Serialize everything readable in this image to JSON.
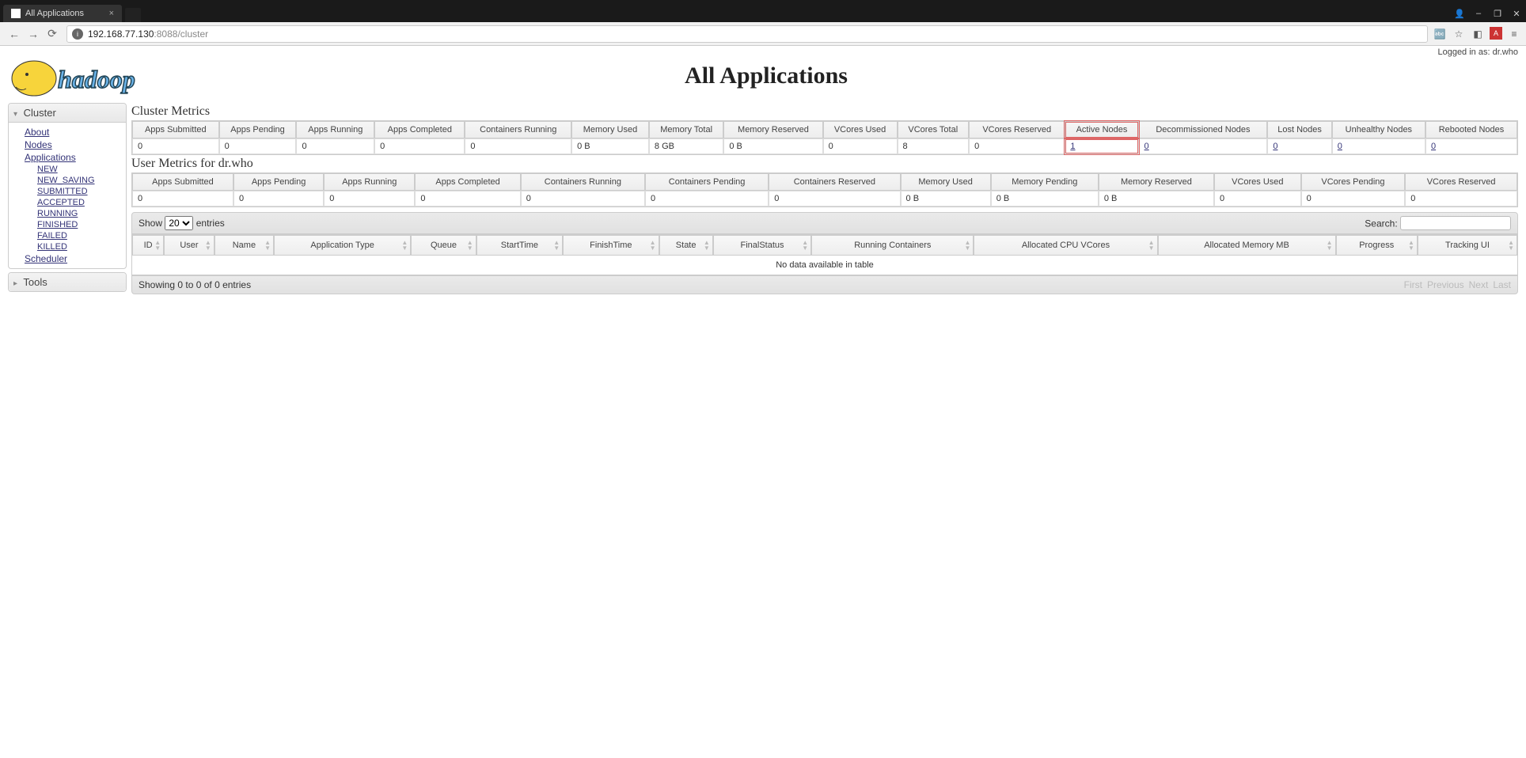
{
  "browser": {
    "tab_title": "All Applications",
    "url_display": "192.168.77.130:8088/cluster",
    "url_host": "192.168.77.130",
    "url_port_path": ":8088/cluster",
    "win_minimize": "–",
    "win_maximize": "❐",
    "win_close": "✕",
    "back_glyph": "←",
    "forward_glyph": "→",
    "reload_glyph": "⟳",
    "translate_glyph": "🔤",
    "star_glyph": "☆",
    "user_glyph": "👤"
  },
  "page": {
    "title": "All Applications",
    "login_text": "Logged in as: dr.who",
    "logo_text": "hadoop"
  },
  "nav": {
    "cluster_title": "Cluster",
    "tools_title": "Tools",
    "links": {
      "about": "About",
      "nodes": "Nodes",
      "applications": "Applications",
      "new": "NEW",
      "new_saving": "NEW_SAVING",
      "submitted": "SUBMITTED",
      "accepted": "ACCEPTED",
      "running": "RUNNING",
      "finished": "FINISHED",
      "failed": "FAILED",
      "killed": "KILLED",
      "scheduler": "Scheduler"
    }
  },
  "cluster_metrics": {
    "title": "Cluster Metrics",
    "headers": {
      "apps_submitted": "Apps Submitted",
      "apps_pending": "Apps Pending",
      "apps_running": "Apps Running",
      "apps_completed": "Apps Completed",
      "containers_running": "Containers Running",
      "memory_used": "Memory Used",
      "memory_total": "Memory Total",
      "memory_reserved": "Memory Reserved",
      "vcores_used": "VCores Used",
      "vcores_total": "VCores Total",
      "vcores_reserved": "VCores Reserved",
      "active_nodes": "Active Nodes",
      "decommissioned_nodes": "Decommissioned Nodes",
      "lost_nodes": "Lost Nodes",
      "unhealthy_nodes": "Unhealthy Nodes",
      "rebooted_nodes": "Rebooted Nodes"
    },
    "values": {
      "apps_submitted": "0",
      "apps_pending": "0",
      "apps_running": "0",
      "apps_completed": "0",
      "containers_running": "0",
      "memory_used": "0 B",
      "memory_total": "8 GB",
      "memory_reserved": "0 B",
      "vcores_used": "0",
      "vcores_total": "8",
      "vcores_reserved": "0",
      "active_nodes": "1",
      "decommissioned_nodes": "0",
      "lost_nodes": "0",
      "unhealthy_nodes": "0",
      "rebooted_nodes": "0"
    }
  },
  "user_metrics": {
    "title": "User Metrics for dr.who",
    "headers": {
      "apps_submitted": "Apps Submitted",
      "apps_pending": "Apps Pending",
      "apps_running": "Apps Running",
      "apps_completed": "Apps Completed",
      "containers_running": "Containers Running",
      "containers_pending": "Containers Pending",
      "containers_reserved": "Containers Reserved",
      "memory_used": "Memory Used",
      "memory_pending": "Memory Pending",
      "memory_reserved": "Memory Reserved",
      "vcores_used": "VCores Used",
      "vcores_pending": "VCores Pending",
      "vcores_reserved": "VCores Reserved"
    },
    "values": {
      "apps_submitted": "0",
      "apps_pending": "0",
      "apps_running": "0",
      "apps_completed": "0",
      "containers_running": "0",
      "containers_pending": "0",
      "containers_reserved": "0",
      "memory_used": "0 B",
      "memory_pending": "0 B",
      "memory_reserved": "0 B",
      "vcores_used": "0",
      "vcores_pending": "0",
      "vcores_reserved": "0"
    }
  },
  "datatable": {
    "show_label": "Show",
    "page_size": "20",
    "entries_label": "entries",
    "search_label": "Search:",
    "columns": {
      "id": "ID",
      "user": "User",
      "name": "Name",
      "app_type": "Application Type",
      "queue": "Queue",
      "start_time": "StartTime",
      "finish_time": "FinishTime",
      "state": "State",
      "final_status": "FinalStatus",
      "running_containers": "Running Containers",
      "allocated_vcores": "Allocated CPU VCores",
      "allocated_memory": "Allocated Memory MB",
      "progress": "Progress",
      "tracking_ui": "Tracking UI"
    },
    "empty_msg": "No data available in table",
    "info": "Showing 0 to 0 of 0 entries",
    "paginate": {
      "first": "First",
      "previous": "Previous",
      "next": "Next",
      "last": "Last"
    }
  }
}
